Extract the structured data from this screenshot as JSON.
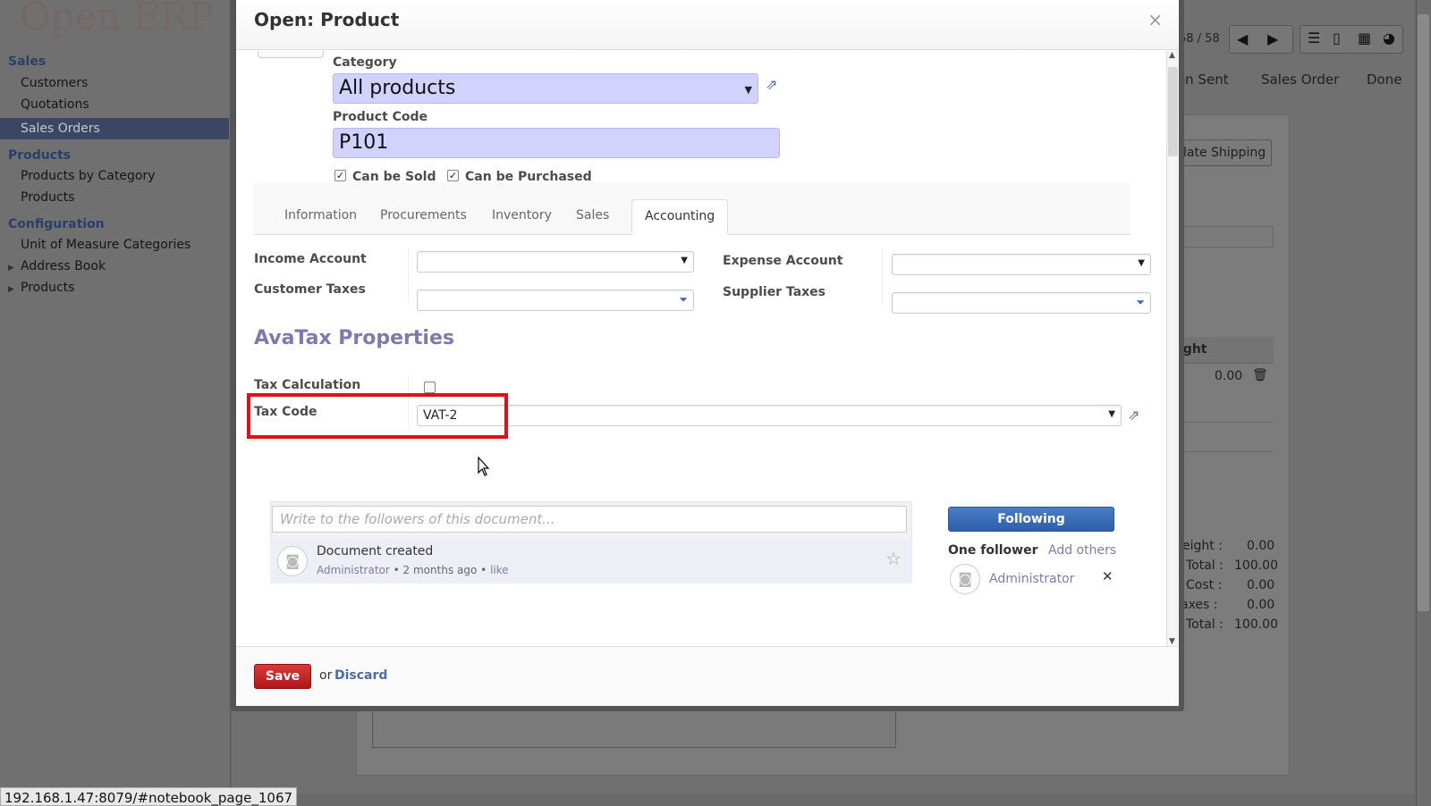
{
  "app": {
    "logo_open": "Open",
    "logo_erp": "ERP"
  },
  "sidebar": {
    "sections": [
      {
        "label": "Sales",
        "items": [
          "Customers",
          "Quotations",
          "Sales Orders"
        ]
      },
      {
        "label": "Products",
        "items": [
          "Products by Category",
          "Products"
        ]
      },
      {
        "label": "Configuration",
        "items": [
          "Unit of Measure Categories",
          "Address Book",
          "Products"
        ]
      }
    ]
  },
  "background": {
    "pager": "58 / 58",
    "status_steps": [
      "on Sent",
      "Sales Order",
      "Done"
    ],
    "shipping_button": "late Shipping",
    "line_header": "ight",
    "line_value": "0.00",
    "totals": [
      {
        "label": "eight :",
        "value": "0.00"
      },
      {
        "label": "Total :",
        "value": "100.00"
      },
      {
        "label": "Cost :",
        "value": "0.00"
      },
      {
        "label": "axes :",
        "value": "0.00"
      },
      {
        "label": "Total :",
        "value": "100.00"
      }
    ]
  },
  "modal": {
    "title": "Open: Product",
    "close": "×",
    "category_label": "Category",
    "category_value": "All products",
    "product_code_label": "Product Code",
    "product_code_value": "P101",
    "can_be_sold": "Can be Sold",
    "can_be_purchased": "Can be Purchased",
    "tabs": [
      "Information",
      "Procurements",
      "Inventory",
      "Sales",
      "Accounting"
    ],
    "active_tab": "Accounting",
    "income_account_label": "Income Account",
    "customer_taxes_label": "Customer Taxes",
    "expense_account_label": "Expense Account",
    "supplier_taxes_label": "Supplier Taxes",
    "avatax_title": "AvaTax Properties",
    "tax_calculation_label": "Tax Calculation",
    "tax_code_label": "Tax Code",
    "tax_code_value": "VAT-2",
    "chatter": {
      "placeholder": "Write to the followers of this document...",
      "message_title": "Document created",
      "message_author": "Administrator",
      "message_sep": "•",
      "message_time": "2 months ago",
      "message_like": "like",
      "following_button": "Following",
      "followers_label": "One follower",
      "add_others": "Add others",
      "follower_name": "Administrator",
      "remove": "✕"
    },
    "footer": {
      "save": "Save",
      "or": "or",
      "discard": "Discard"
    }
  },
  "status_url": "192.168.1.47:8079/#notebook_page_1067",
  "colors": {
    "highlight_box": "#e01018",
    "required_field": "#d2d2ff",
    "primary": "#2e5fa8",
    "save": "#b21616"
  }
}
